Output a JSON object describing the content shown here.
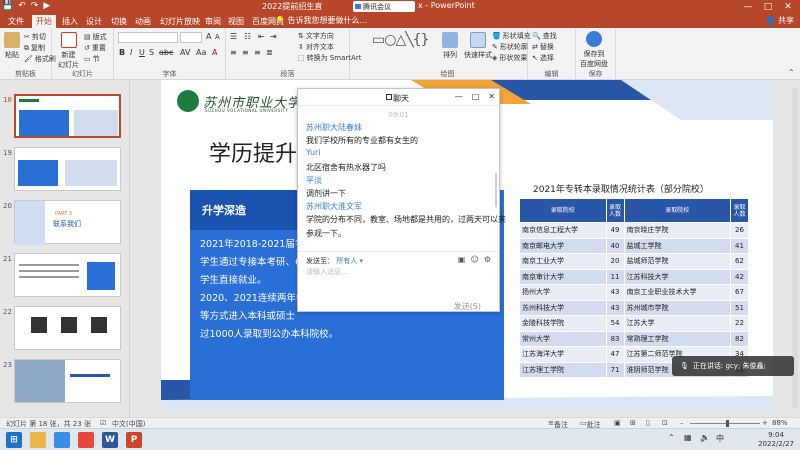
{
  "window": {
    "title": "2022提前招生直播…ptx - PowerPoint",
    "title_prefix": "2022提前招生直",
    "title_suffix": "x - PowerPoint",
    "meeting_pill": "腾讯会议",
    "meeting_icon": "video-icon",
    "controls": [
      "—",
      "□",
      "✕"
    ]
  },
  "qat": [
    "💾",
    "↶",
    "↷",
    "▶"
  ],
  "tabs": [
    {
      "label": "文件",
      "active": false
    },
    {
      "label": "开始",
      "active": true
    },
    {
      "label": "插入",
      "active": false
    },
    {
      "label": "设计",
      "active": false
    },
    {
      "label": "切换",
      "active": false
    },
    {
      "label": "动画",
      "active": false
    },
    {
      "label": "幻灯片放映",
      "active": false
    },
    {
      "label": "审阅",
      "active": false
    },
    {
      "label": "视图",
      "active": false
    },
    {
      "label": "百度网盘",
      "active": false
    }
  ],
  "tell_me": "告诉我您想要做什么...",
  "share": "共享",
  "ribbon": {
    "clipboard": {
      "label": "剪贴板",
      "paste": "粘贴",
      "cut": "剪切",
      "copy": "复制",
      "format_painter": "格式刷"
    },
    "slides": {
      "label": "幻灯片",
      "new_slide": "新建\n幻灯片",
      "layout": "版式",
      "reset": "重置",
      "section": "节"
    },
    "font": {
      "label": "字体"
    },
    "paragraph": {
      "label": "段落",
      "text_direction": "文字方向",
      "align_text": "对齐文本",
      "smartart": "转换为 SmartArt"
    },
    "drawing": {
      "label": "绘图",
      "arrange": "排列",
      "quick_styles": "快速样式",
      "shape_fill": "形状填充",
      "shape_outline": "形状轮廓",
      "shape_effects": "形状效果"
    },
    "editing": {
      "label": "编辑",
      "find": "查找",
      "replace": "替换",
      "select": "选择"
    },
    "save": {
      "label": "保存",
      "save_baidu": "保存到\n百度网盘"
    }
  },
  "thumbnails": [
    {
      "num": "18",
      "active": true
    },
    {
      "num": "19",
      "active": false
    },
    {
      "num": "20",
      "active": false
    },
    {
      "num": "21",
      "active": false
    },
    {
      "num": "22",
      "active": false
    },
    {
      "num": "23",
      "active": false
    }
  ],
  "thumb_texts": {
    "t20_part": "PART 3",
    "t20_title": "联系我们"
  },
  "slide": {
    "logo_text": "苏州市职业大学",
    "logo_sub": "SUZHOU VOCATIONAL UNIVERSITY",
    "title": "学历提升",
    "box_heading": "升学深造",
    "box_lines": [
      "2021年2018-2021届学生",
      "学生通过专接本考研、6",
      "学生直接就业。",
      "2020、2021连续两年每年",
      "等方式进入本科或硕士",
      "过1000人录取到公办本科院校。"
    ],
    "table_title": "2021年专转本录取情况统计表（部分院校）",
    "table_headers": [
      "录取院校",
      "录取\n人数",
      "录取院校",
      "录取\n人数"
    ],
    "table_rows": [
      [
        "南京信息工程大学",
        "49",
        "南京晓庄学院",
        "26"
      ],
      [
        "南京邮电大学",
        "40",
        "盐城工学院",
        "41"
      ],
      [
        "南京工业大学",
        "20",
        "盐城师范学院",
        "62"
      ],
      [
        "南京审计大学",
        "11",
        "江苏科技大学",
        "42"
      ],
      [
        "扬州大学",
        "43",
        "南京工业职业技术大学",
        "67"
      ],
      [
        "苏州科技大学",
        "43",
        "苏州城市学院",
        "51"
      ],
      [
        "金陵科技学院",
        "54",
        "江苏大学",
        "22"
      ],
      [
        "常州大学",
        "83",
        "常熟理工学院",
        "82"
      ],
      [
        "江苏海洋大学",
        "47",
        "江苏第二师范学院",
        "34"
      ],
      [
        "江苏理工学院",
        "71",
        "淮阴师范学院",
        "31"
      ]
    ]
  },
  "chat": {
    "title": "聊天",
    "time": "09:01",
    "messages": [
      {
        "type": "sender",
        "text": "苏州职大陆春妹"
      },
      {
        "type": "text",
        "text": "我们学校所有的专业都有女生的"
      },
      {
        "type": "sender",
        "text": "Yuri"
      },
      {
        "type": "text",
        "text": "北区宿舍有热水器了吗"
      },
      {
        "type": "sender",
        "text": "平淡"
      },
      {
        "type": "text",
        "text": "调剂讲一下"
      },
      {
        "type": "sender",
        "text": "苏州职大淮文军"
      },
      {
        "type": "text",
        "text": "学院的分布不同，教室、场地都是共用的，过两天可以来"
      },
      {
        "type": "text",
        "text": "参观一下。"
      }
    ],
    "send_to_label": "发送至：",
    "send_to_value": "所有人 ▾",
    "input_placeholder": "请输入消息...",
    "send_button": "发送(S)"
  },
  "toast": {
    "text": "正在讲话: gcy; 朱俊鑫;"
  },
  "statusbar": {
    "slide_info": "幻灯片 第 18 张，共 23 张",
    "language": "中文(中国)",
    "notes": "备注",
    "comments": "批注",
    "zoom": "88%"
  },
  "taskbar": {
    "time": "9:04",
    "date": "2022/2/27",
    "ime": "中",
    "apps": [
      {
        "name": "file-explorer-icon",
        "color": "#e8b64a",
        "glyph": ""
      },
      {
        "name": "browser-icon",
        "color": "#3c8be6",
        "glyph": ""
      },
      {
        "name": "chrome-icon",
        "color": "#e5473a",
        "glyph": ""
      },
      {
        "name": "word-icon",
        "color": "#2b5797",
        "glyph": "W"
      },
      {
        "name": "powerpoint-icon",
        "color": "#c9452b",
        "glyph": "P"
      }
    ]
  }
}
